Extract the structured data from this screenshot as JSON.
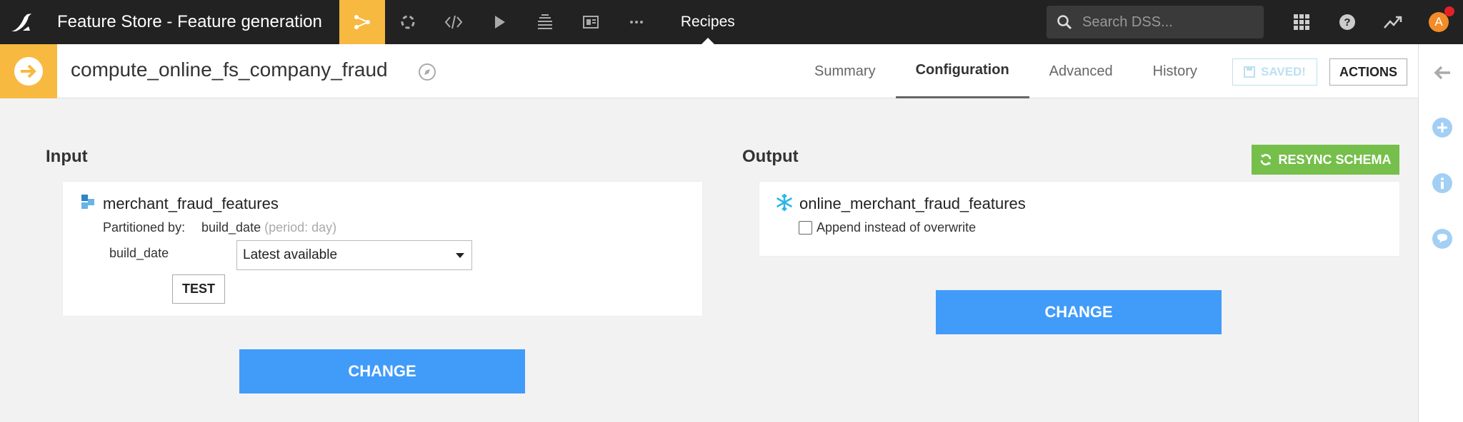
{
  "topbar": {
    "project_title": "Feature Store - Feature generation",
    "section_label": "Recipes",
    "search_placeholder": "Search DSS...",
    "avatar_initial": "A",
    "nav_icons": [
      "flow-icon",
      "jobs-icon",
      "code-icon",
      "run-icon",
      "datasets-icon",
      "dashboard-icon",
      "more-icon"
    ]
  },
  "header": {
    "recipe_name": "compute_online_fs_company_fraud",
    "tabs": [
      {
        "label": "Summary"
      },
      {
        "label": "Configuration"
      },
      {
        "label": "Advanced"
      },
      {
        "label": "History"
      }
    ],
    "saved_label": "SAVED!",
    "actions_label": "ACTIONS"
  },
  "input": {
    "title": "Input",
    "dataset_name": "merchant_fraud_features",
    "partitioned_label": "Partitioned by:",
    "partition_field": "build_date",
    "partition_period": "(period: day)",
    "dimension_label": "build_date",
    "selected_value": "Latest available",
    "test_label": "TEST",
    "change_label": "CHANGE"
  },
  "output": {
    "title": "Output",
    "resync_label": "RESYNC SCHEMA",
    "dataset_name": "online_merchant_fraud_features",
    "append_label": "Append instead of overwrite",
    "change_label": "CHANGE"
  },
  "colors": {
    "accent_yellow": "#f8b940",
    "primary_blue": "#419bf9",
    "resync_green": "#76bf4b",
    "topbar_bg": "#222222"
  }
}
